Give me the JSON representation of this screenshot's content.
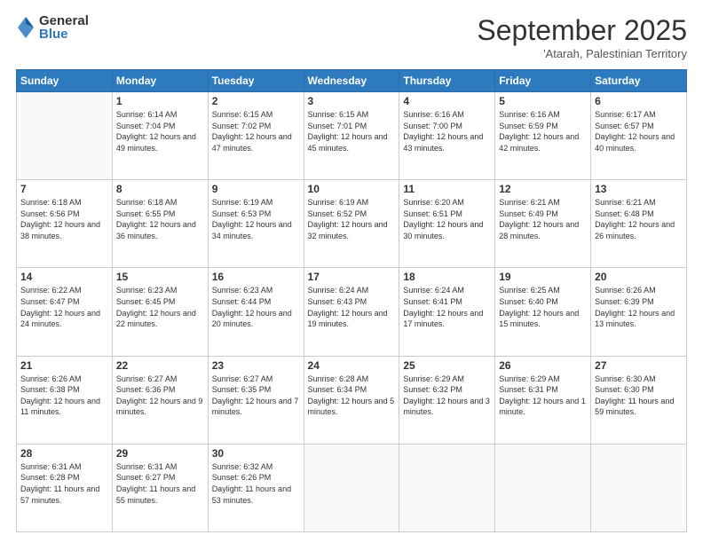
{
  "logo": {
    "general": "General",
    "blue": "Blue"
  },
  "header": {
    "month": "September 2025",
    "location": "'Atarah, Palestinian Territory"
  },
  "days_of_week": [
    "Sunday",
    "Monday",
    "Tuesday",
    "Wednesday",
    "Thursday",
    "Friday",
    "Saturday"
  ],
  "weeks": [
    [
      {
        "day": "",
        "sunrise": "",
        "sunset": "",
        "daylight": ""
      },
      {
        "day": "1",
        "sunrise": "Sunrise: 6:14 AM",
        "sunset": "Sunset: 7:04 PM",
        "daylight": "Daylight: 12 hours and 49 minutes."
      },
      {
        "day": "2",
        "sunrise": "Sunrise: 6:15 AM",
        "sunset": "Sunset: 7:02 PM",
        "daylight": "Daylight: 12 hours and 47 minutes."
      },
      {
        "day": "3",
        "sunrise": "Sunrise: 6:15 AM",
        "sunset": "Sunset: 7:01 PM",
        "daylight": "Daylight: 12 hours and 45 minutes."
      },
      {
        "day": "4",
        "sunrise": "Sunrise: 6:16 AM",
        "sunset": "Sunset: 7:00 PM",
        "daylight": "Daylight: 12 hours and 43 minutes."
      },
      {
        "day": "5",
        "sunrise": "Sunrise: 6:16 AM",
        "sunset": "Sunset: 6:59 PM",
        "daylight": "Daylight: 12 hours and 42 minutes."
      },
      {
        "day": "6",
        "sunrise": "Sunrise: 6:17 AM",
        "sunset": "Sunset: 6:57 PM",
        "daylight": "Daylight: 12 hours and 40 minutes."
      }
    ],
    [
      {
        "day": "7",
        "sunrise": "Sunrise: 6:18 AM",
        "sunset": "Sunset: 6:56 PM",
        "daylight": "Daylight: 12 hours and 38 minutes."
      },
      {
        "day": "8",
        "sunrise": "Sunrise: 6:18 AM",
        "sunset": "Sunset: 6:55 PM",
        "daylight": "Daylight: 12 hours and 36 minutes."
      },
      {
        "day": "9",
        "sunrise": "Sunrise: 6:19 AM",
        "sunset": "Sunset: 6:53 PM",
        "daylight": "Daylight: 12 hours and 34 minutes."
      },
      {
        "day": "10",
        "sunrise": "Sunrise: 6:19 AM",
        "sunset": "Sunset: 6:52 PM",
        "daylight": "Daylight: 12 hours and 32 minutes."
      },
      {
        "day": "11",
        "sunrise": "Sunrise: 6:20 AM",
        "sunset": "Sunset: 6:51 PM",
        "daylight": "Daylight: 12 hours and 30 minutes."
      },
      {
        "day": "12",
        "sunrise": "Sunrise: 6:21 AM",
        "sunset": "Sunset: 6:49 PM",
        "daylight": "Daylight: 12 hours and 28 minutes."
      },
      {
        "day": "13",
        "sunrise": "Sunrise: 6:21 AM",
        "sunset": "Sunset: 6:48 PM",
        "daylight": "Daylight: 12 hours and 26 minutes."
      }
    ],
    [
      {
        "day": "14",
        "sunrise": "Sunrise: 6:22 AM",
        "sunset": "Sunset: 6:47 PM",
        "daylight": "Daylight: 12 hours and 24 minutes."
      },
      {
        "day": "15",
        "sunrise": "Sunrise: 6:23 AM",
        "sunset": "Sunset: 6:45 PM",
        "daylight": "Daylight: 12 hours and 22 minutes."
      },
      {
        "day": "16",
        "sunrise": "Sunrise: 6:23 AM",
        "sunset": "Sunset: 6:44 PM",
        "daylight": "Daylight: 12 hours and 20 minutes."
      },
      {
        "day": "17",
        "sunrise": "Sunrise: 6:24 AM",
        "sunset": "Sunset: 6:43 PM",
        "daylight": "Daylight: 12 hours and 19 minutes."
      },
      {
        "day": "18",
        "sunrise": "Sunrise: 6:24 AM",
        "sunset": "Sunset: 6:41 PM",
        "daylight": "Daylight: 12 hours and 17 minutes."
      },
      {
        "day": "19",
        "sunrise": "Sunrise: 6:25 AM",
        "sunset": "Sunset: 6:40 PM",
        "daylight": "Daylight: 12 hours and 15 minutes."
      },
      {
        "day": "20",
        "sunrise": "Sunrise: 6:26 AM",
        "sunset": "Sunset: 6:39 PM",
        "daylight": "Daylight: 12 hours and 13 minutes."
      }
    ],
    [
      {
        "day": "21",
        "sunrise": "Sunrise: 6:26 AM",
        "sunset": "Sunset: 6:38 PM",
        "daylight": "Daylight: 12 hours and 11 minutes."
      },
      {
        "day": "22",
        "sunrise": "Sunrise: 6:27 AM",
        "sunset": "Sunset: 6:36 PM",
        "daylight": "Daylight: 12 hours and 9 minutes."
      },
      {
        "day": "23",
        "sunrise": "Sunrise: 6:27 AM",
        "sunset": "Sunset: 6:35 PM",
        "daylight": "Daylight: 12 hours and 7 minutes."
      },
      {
        "day": "24",
        "sunrise": "Sunrise: 6:28 AM",
        "sunset": "Sunset: 6:34 PM",
        "daylight": "Daylight: 12 hours and 5 minutes."
      },
      {
        "day": "25",
        "sunrise": "Sunrise: 6:29 AM",
        "sunset": "Sunset: 6:32 PM",
        "daylight": "Daylight: 12 hours and 3 minutes."
      },
      {
        "day": "26",
        "sunrise": "Sunrise: 6:29 AM",
        "sunset": "Sunset: 6:31 PM",
        "daylight": "Daylight: 12 hours and 1 minute."
      },
      {
        "day": "27",
        "sunrise": "Sunrise: 6:30 AM",
        "sunset": "Sunset: 6:30 PM",
        "daylight": "Daylight: 11 hours and 59 minutes."
      }
    ],
    [
      {
        "day": "28",
        "sunrise": "Sunrise: 6:31 AM",
        "sunset": "Sunset: 6:28 PM",
        "daylight": "Daylight: 11 hours and 57 minutes."
      },
      {
        "day": "29",
        "sunrise": "Sunrise: 6:31 AM",
        "sunset": "Sunset: 6:27 PM",
        "daylight": "Daylight: 11 hours and 55 minutes."
      },
      {
        "day": "30",
        "sunrise": "Sunrise: 6:32 AM",
        "sunset": "Sunset: 6:26 PM",
        "daylight": "Daylight: 11 hours and 53 minutes."
      },
      {
        "day": "",
        "sunrise": "",
        "sunset": "",
        "daylight": ""
      },
      {
        "day": "",
        "sunrise": "",
        "sunset": "",
        "daylight": ""
      },
      {
        "day": "",
        "sunrise": "",
        "sunset": "",
        "daylight": ""
      },
      {
        "day": "",
        "sunrise": "",
        "sunset": "",
        "daylight": ""
      }
    ]
  ]
}
